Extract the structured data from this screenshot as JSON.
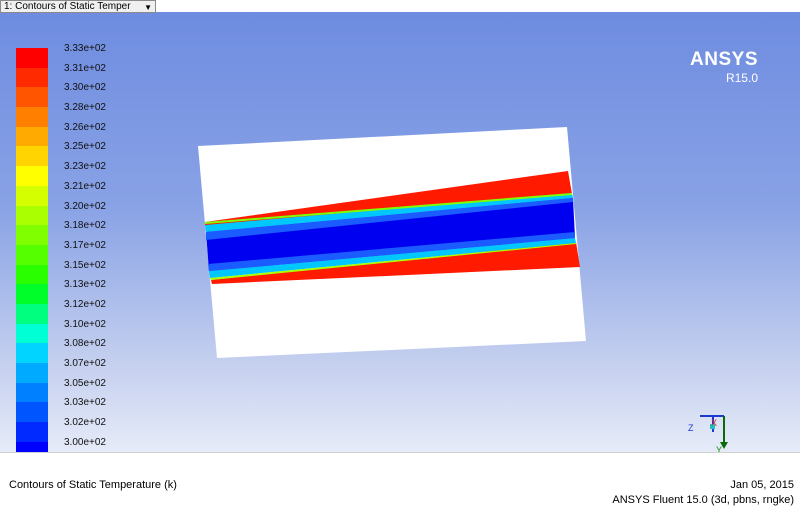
{
  "toolbar": {
    "dropdown_value": "1: Contours of Static Temper"
  },
  "brand": {
    "name": "ANSYS",
    "version": "R15.0"
  },
  "legend": {
    "labels": [
      "3.33e+02",
      "3.31e+02",
      "3.30e+02",
      "3.28e+02",
      "3.26e+02",
      "3.25e+02",
      "3.23e+02",
      "3.21e+02",
      "3.20e+02",
      "3.18e+02",
      "3.17e+02",
      "3.15e+02",
      "3.13e+02",
      "3.12e+02",
      "3.10e+02",
      "3.08e+02",
      "3.07e+02",
      "3.05e+02",
      "3.03e+02",
      "3.02e+02",
      "3.00e+02"
    ],
    "colors": [
      "#ff0000",
      "#ff2a00",
      "#ff5500",
      "#ff7f00",
      "#ffaa00",
      "#ffd400",
      "#ffff00",
      "#d4ff00",
      "#aaff00",
      "#7fff00",
      "#55ff00",
      "#2aff00",
      "#00ff2a",
      "#00ff7f",
      "#00ffd4",
      "#00d4ff",
      "#00aaff",
      "#007fff",
      "#0055ff",
      "#002aff",
      "#0000ff"
    ]
  },
  "axes": {
    "z": "Z",
    "x": "X",
    "y": "Y"
  },
  "footer": {
    "title": "Contours of Static Temperature (k)",
    "date": "Jan 05, 2015",
    "solver": "ANSYS Fluent 15.0 (3d, pbns, rngke)"
  }
}
